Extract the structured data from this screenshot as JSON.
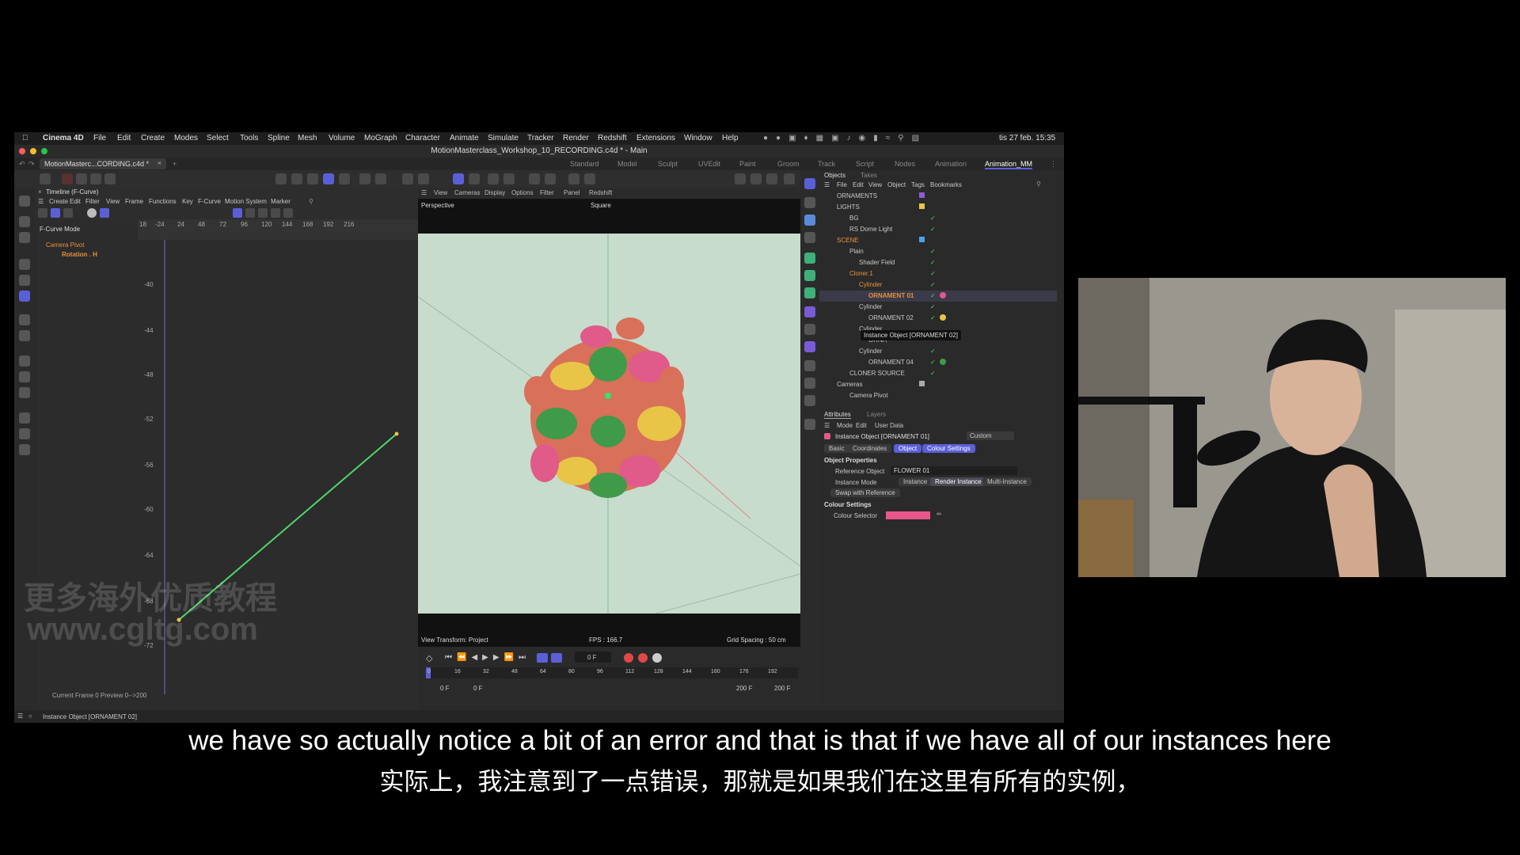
{
  "menubar": {
    "app": "Cinema 4D",
    "items": [
      "File",
      "Edit",
      "Create",
      "Modes",
      "Select",
      "Tools",
      "Spline",
      "Mesh",
      "Volume",
      "MoGraph",
      "Character",
      "Animate",
      "Simulate",
      "Tracker",
      "Render",
      "Redshift",
      "Extensions",
      "Window",
      "Help"
    ],
    "clock": "tis 27 feb. 15:35"
  },
  "window": {
    "title": "MotionMasterclass_Workshop_10_RECORDING.c4d * - Main"
  },
  "tabs": {
    "doc_tab": "MotionMasterc...CORDING.c4d *"
  },
  "layouts": [
    "Standard",
    "Model",
    "Sculpt",
    "UVEdit",
    "Paint",
    "Groom",
    "Track",
    "Script",
    "Nodes",
    "Animation",
    "Animation_MM"
  ],
  "timeline": {
    "title": "Timeline (F-Curve)",
    "menu": [
      "Create",
      "Edit",
      "Filter",
      "View",
      "Frame",
      "Functions",
      "Key",
      "F-Curve",
      "Motion System",
      "Marker"
    ],
    "mode_label": "F-Curve Mode",
    "tree": [
      "Camera Pivot",
      "Rotation . H"
    ],
    "x_ticks": [
      "18",
      "-24",
      "24",
      "48",
      "72",
      "96",
      "120",
      "144",
      "168",
      "192",
      "216"
    ],
    "y_ticks": [
      "-40",
      "-44",
      "-48",
      "-52",
      "-56",
      "-60",
      "-64",
      "-68",
      "-72"
    ],
    "status": "Current Frame  0  Preview  0-->200"
  },
  "viewport": {
    "menu": [
      "View",
      "Cameras",
      "Display",
      "Options",
      "Filter",
      "Panel",
      "Redshift"
    ],
    "camera": "Perspective",
    "aspect": "Square",
    "view_transform": "View Transform: Project",
    "fps": "FPS : 166.7",
    "grid": "Grid Spacing : 50 cm"
  },
  "transport": {
    "frame_field": "0 F",
    "ticks": [
      "0",
      "16",
      "32",
      "48",
      "64",
      "80",
      "96",
      "112",
      "128",
      "144",
      "160",
      "176",
      "192"
    ],
    "start1": "0 F",
    "start2": "0 F",
    "end1": "200 F",
    "end2": "200 F"
  },
  "objects": {
    "tabs": [
      "Objects",
      "Takes"
    ],
    "menu": [
      "File",
      "Edit",
      "View",
      "Object",
      "Tags",
      "Bookmarks"
    ],
    "rows": [
      "ORNAMENTS",
      "LIGHTS",
      "BG",
      "RS Dome Light",
      "SCENE",
      "Plain",
      "Shader Field",
      "Cloner.1",
      "Cylinder",
      "ORNAMENT 01",
      "Cylinder",
      "ORNAMENT 02",
      "Cylinder",
      "ORNA",
      "Cylinder",
      "ORNAMENT 04",
      "CLONER SOURCE",
      "Cameras",
      "Camera Pivot"
    ],
    "tooltip": "Instance Object [ORNAMENT 02]"
  },
  "attributes": {
    "tabs": [
      "Attributes",
      "Layers"
    ],
    "menu": [
      "Mode",
      "Edit",
      "User Data"
    ],
    "object_title": "Instance Object [ORNAMENT 01]",
    "preset": "Custom",
    "subtabs": [
      "Basic",
      "Coordinates",
      "Object",
      "Colour Settings"
    ],
    "section1": "Object Properties",
    "ref_label": "Reference Object",
    "ref_value": "FLOWER 01",
    "mode_label": "Instance Mode",
    "mode_options": [
      "Instance",
      "Render Instance",
      "Multi-Instance"
    ],
    "swap_button": "Swap with Reference",
    "section2": "Colour Settings",
    "colour_label": "Colour Selector",
    "colour": "#e8578a"
  },
  "statusbar": {
    "text": "Instance Object [ORNAMENT 02]"
  },
  "watermark": {
    "line1": "更多海外优质教程",
    "line2": "www.cgltg.com"
  },
  "subtitles": {
    "en": "we have so actually notice a bit of an error and that is that if we have all of our instances here",
    "zh": "实际上，我注意到了一点错误，那就是如果我们在这里有所有的实例，"
  },
  "colors": {
    "accent": "#5b5fd6",
    "curve": "#4fd66a",
    "orange": "#e8913a",
    "yellow": "#e8c547"
  }
}
